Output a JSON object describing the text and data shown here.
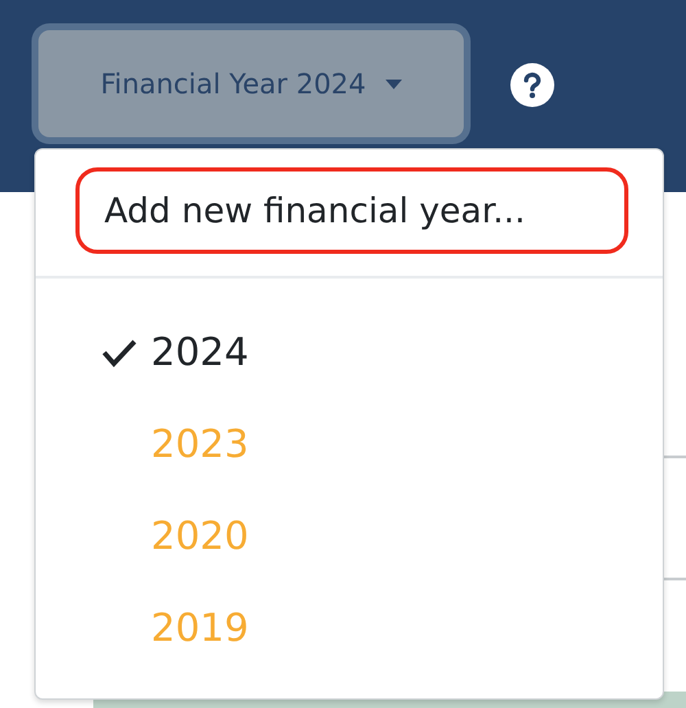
{
  "year_selector": {
    "label": "Financial Year 2024",
    "expanded": true
  },
  "menu": {
    "add_item": {
      "label": "Add new financial year...",
      "highlighted": true
    },
    "years": [
      {
        "label": "2024",
        "selected": true,
        "color": "#212529"
      },
      {
        "label": "2023",
        "selected": false,
        "color": "#f7ac34"
      },
      {
        "label": "2020",
        "selected": false,
        "color": "#f7ac34"
      },
      {
        "label": "2019",
        "selected": false,
        "color": "#f7ac34"
      }
    ]
  }
}
